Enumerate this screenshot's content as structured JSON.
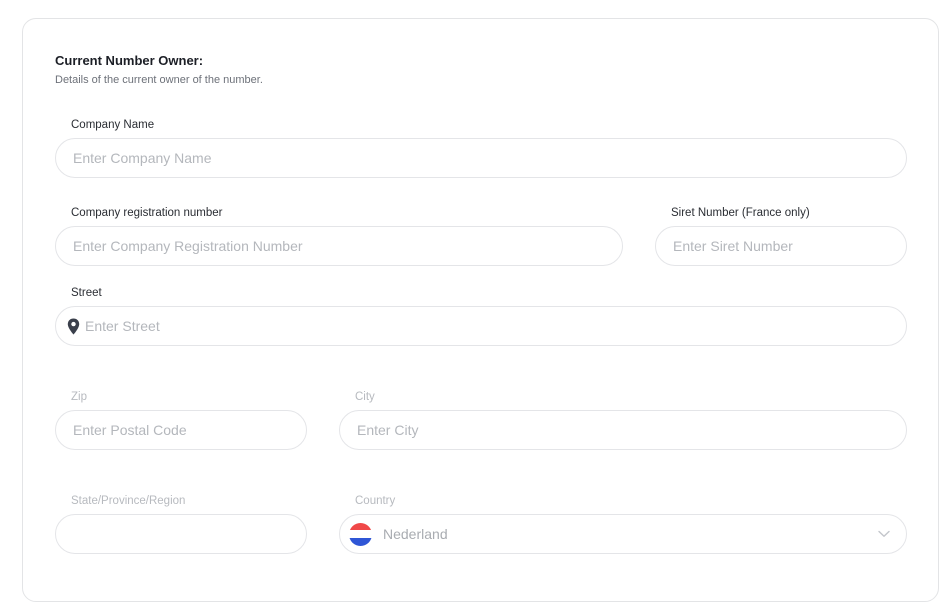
{
  "section": {
    "title": "Current Number Owner:",
    "subtitle": "Details of the current owner of the number."
  },
  "fields": {
    "company_name": {
      "label": "Company Name",
      "placeholder": "Enter Company Name",
      "value": ""
    },
    "registration_number": {
      "label": "Company registration number",
      "placeholder": "Enter Company Registration Number",
      "value": ""
    },
    "siret_number": {
      "label": "Siret Number (France only)",
      "placeholder": "Enter Siret Number",
      "value": ""
    },
    "street": {
      "label": "Street",
      "placeholder": "Enter Street",
      "value": "",
      "icon": "location-pin-icon"
    },
    "zip": {
      "label": "Zip",
      "placeholder": "Enter Postal Code",
      "value": ""
    },
    "city": {
      "label": "City",
      "placeholder": "Enter City",
      "value": ""
    },
    "state": {
      "label": "State/Province/Region",
      "placeholder": "",
      "value": ""
    },
    "country": {
      "label": "Country",
      "selected": "Nederland",
      "icon": "netherlands-flag-icon"
    }
  },
  "colors": {
    "flag_red": "#f04848",
    "flag_white": "#ffffff",
    "flag_blue": "#2f56d6",
    "pin": "#3a3f4b",
    "border": "#e4e5e8"
  }
}
